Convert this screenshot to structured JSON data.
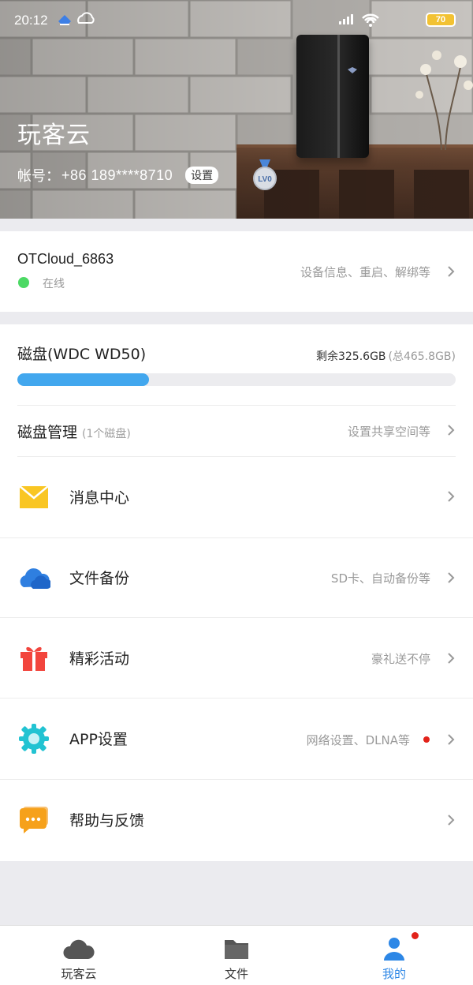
{
  "status_bar": {
    "time": "20:12",
    "battery": "70"
  },
  "header": {
    "title": "玩客云",
    "account_label": "帐号：",
    "account_value": "+86 189****8710",
    "settings_badge": "设置",
    "level": "LV0"
  },
  "device": {
    "name": "OTCloud_6863",
    "status": "在线",
    "hint": "设备信息、重启、解绑等"
  },
  "disk": {
    "title": "磁盘(WDC WD50)",
    "free": "剩余325.6GB",
    "total": "(总465.8GB)",
    "used_fraction": 0.3
  },
  "menu": {
    "disk_mgmt": {
      "label": "磁盘管理",
      "sub": "(1个磁盘)",
      "hint": "设置共享空间等"
    },
    "messages": {
      "label": "消息中心",
      "hint": ""
    },
    "backup": {
      "label": "文件备份",
      "hint": "SD卡、自动备份等"
    },
    "events": {
      "label": "精彩活动",
      "hint": "豪礼送不停"
    },
    "settings": {
      "label": "APP设置",
      "hint": "网络设置、DLNA等"
    },
    "help": {
      "label": "帮助与反馈",
      "hint": ""
    }
  },
  "tabs": [
    {
      "label": "玩客云",
      "icon": "cloud-icon"
    },
    {
      "label": "文件",
      "icon": "folder-icon"
    },
    {
      "label": "我的",
      "icon": "person-icon"
    }
  ],
  "colors": {
    "accent": "#2d87e6",
    "progress": "#42a7ee",
    "online": "#4cd964",
    "badge": "#e2231a",
    "message_icon": "#f9c623",
    "backup_icon": "#2f7fe0",
    "event_icon": "#f2453d",
    "settings_icon": "#22c3d2",
    "help_icon": "#f6a11b"
  }
}
